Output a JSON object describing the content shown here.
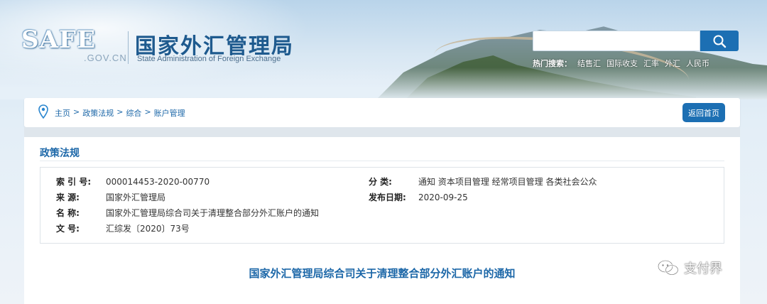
{
  "header": {
    "logo_mark": "SAFE",
    "logo_domain": ".GOV.CN",
    "site_name_cn": "国家外汇管理局",
    "site_name_en": "State Administration of Foreign Exchange",
    "search": {
      "placeholder": "",
      "hot_label": "热门搜索：",
      "hot_terms": [
        "结售汇",
        "国际收支",
        "汇率",
        "外汇",
        "人民币"
      ]
    }
  },
  "breadcrumb": {
    "items": [
      "主页",
      "政策法规",
      "综合",
      "账户管理"
    ],
    "separator": ">",
    "home_button": "返回首页"
  },
  "main": {
    "section_title": "政策法规",
    "meta": {
      "index_label": "索 引 号:",
      "index_value": "000014453-2020-00770",
      "source_label": "来 源:",
      "source_value": "国家外汇管理局",
      "name_label": "名 称:",
      "name_value": "国家外汇管理局综合司关于清理整合部分外汇账户的通知",
      "docno_label": "文 号:",
      "docno_value": "汇综发〔2020〕73号",
      "category_label": "分 类:",
      "category_value": "通知 资本项目管理 经常项目管理 各类社会公众",
      "date_label": "发布日期:",
      "date_value": "2020-09-25"
    },
    "doc_title": "国家外汇管理局综合司关于清理整合部分外汇账户的通知"
  },
  "watermark": "支付界",
  "colors": {
    "accent_blue": "#1c6fb3",
    "link_blue": "#1c67a8"
  }
}
